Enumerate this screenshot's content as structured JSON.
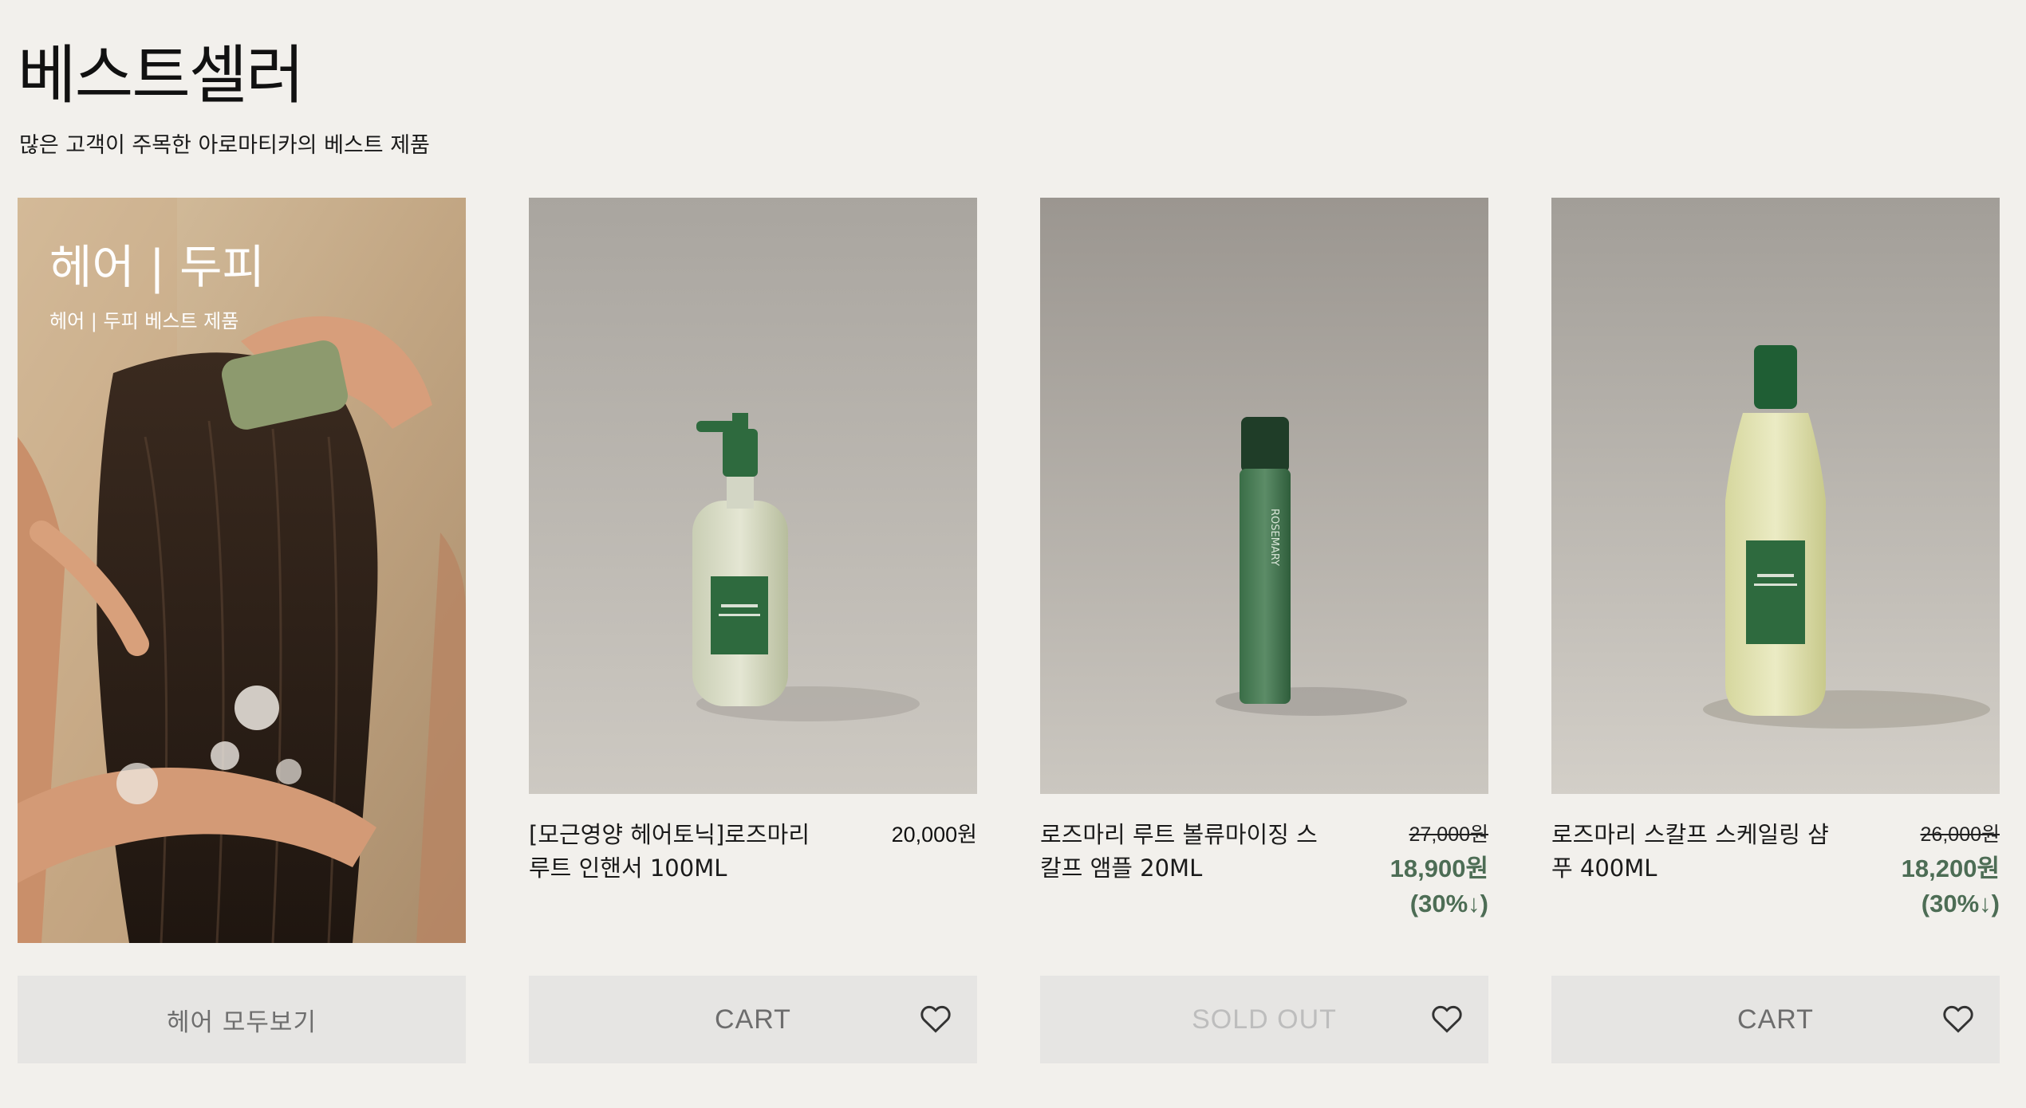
{
  "header": {
    "title": "베스트셀러",
    "subtitle": "많은 고객이 주목한 아로마티카의 베스트 제품"
  },
  "banner": {
    "heading": "헤어 | 두피",
    "caption": "헤어 | 두피 베스트 제품",
    "button_label": "헤어 모두보기"
  },
  "products": [
    {
      "name": "[모근영양 헤어토닉]로즈마리 루트 인핸서 100ML",
      "price": "20,000원",
      "button_label": "CART"
    },
    {
      "name": "로즈마리 루트 볼류마이징 스칼프 앰플 20ML",
      "original_price": "27,000원",
      "sale_price": "18,900원",
      "discount": "(30%↓)",
      "button_label": "SOLD OUT"
    },
    {
      "name": "로즈마리 스칼프 스케일링 샴푸 400ML",
      "original_price": "26,000원",
      "sale_price": "18,200원",
      "discount": "(30%↓)",
      "button_label": "CART"
    }
  ],
  "colors": {
    "background": "#f2f0ec",
    "button_bg": "#e6e5e3",
    "sale_green": "#4d6d55",
    "product_green": "#2e6a3e"
  },
  "icons": [
    "heart-icon"
  ]
}
